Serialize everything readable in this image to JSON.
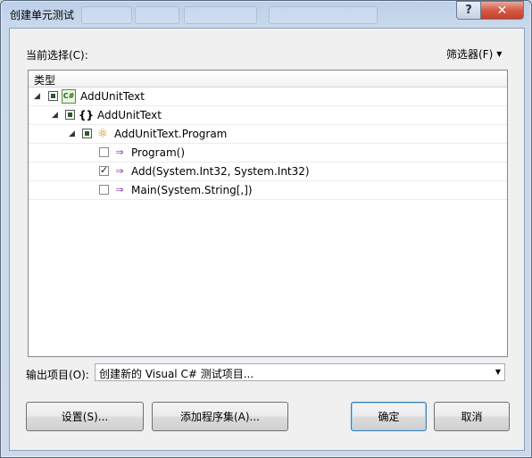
{
  "window": {
    "title": "创建单元测试",
    "help_label": "?",
    "close_label": "✕"
  },
  "selection": {
    "label": "当前选择(C):",
    "filter_label": "筛选器(F)",
    "filter_arrow": "▼"
  },
  "tree": {
    "header": "类型",
    "rows": [
      {
        "text": "AddUnitText",
        "check": "partial",
        "icon": "C#"
      },
      {
        "text": "AddUnitText",
        "check": "partial",
        "icon": "{}"
      },
      {
        "text": "AddUnitText.Program",
        "check": "partial",
        "icon": "⚛"
      },
      {
        "text": "Program()",
        "check": "unchecked",
        "icon": "⇒"
      },
      {
        "text": "Add(System.Int32, System.Int32)",
        "check": "checked",
        "icon": "⇒"
      },
      {
        "text": "Main(System.String[,])",
        "check": "unchecked",
        "icon": "⇒"
      }
    ]
  },
  "output": {
    "label": "输出项目(O):",
    "value": "创建新的 Visual C# 测试项目...",
    "arrow": "▼"
  },
  "buttons": {
    "settings": "设置(S)...",
    "add_assembly": "添加程序集(A)...",
    "ok": "确定",
    "cancel": "取消"
  }
}
